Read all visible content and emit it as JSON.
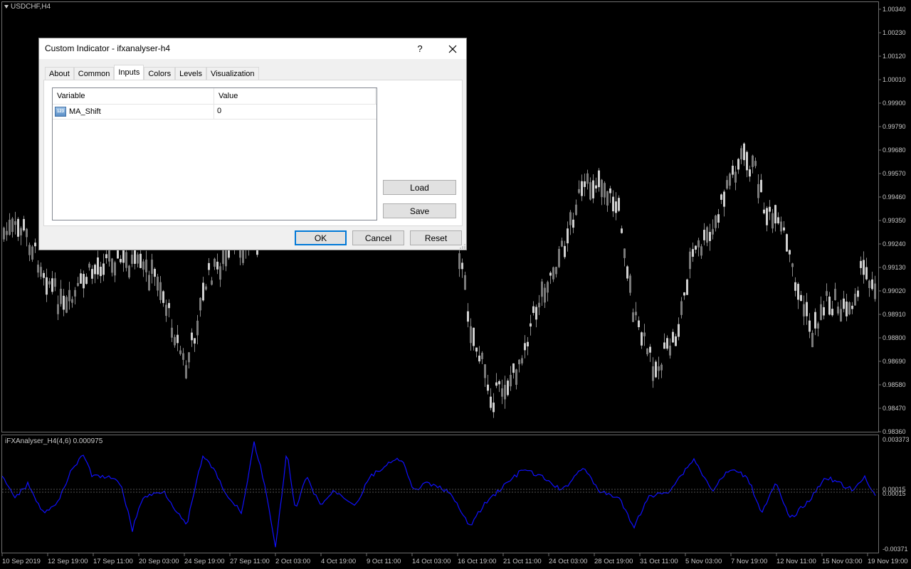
{
  "chart": {
    "symbol_label": "USDCHF,H4",
    "price_axis": [
      "1.00340",
      "1.00230",
      "1.00120",
      "1.00010",
      "0.99900",
      "0.99790",
      "0.99680",
      "0.99570",
      "0.99460",
      "0.99350",
      "0.99240",
      "0.99130",
      "0.99020",
      "0.98910",
      "0.98800",
      "0.98690",
      "0.98580",
      "0.98470",
      "0.98360"
    ],
    "indicator_label": "iFXAnalyser_H4(4,6) 0.000975",
    "indicator_axis_top": "0.003373",
    "indicator_axis_mid1": "0.00015",
    "indicator_axis_mid2": "0.00015",
    "indicator_axis_bottom": "-0.00371",
    "time_axis": [
      "10 Sep 2019",
      "12 Sep 19:00",
      "17 Sep 11:00",
      "20 Sep 03:00",
      "24 Sep 19:00",
      "27 Sep 11:00",
      "2 Oct 03:00",
      "4 Oct 19:00",
      "9 Oct 11:00",
      "14 Oct 03:00",
      "16 Oct 19:00",
      "21 Oct 11:00",
      "24 Oct 03:00",
      "28 Oct 19:00",
      "31 Oct 11:00",
      "5 Nov 03:00",
      "7 Nov 19:00",
      "12 Nov 11:00",
      "15 Nov 03:00",
      "19 Nov 19:00"
    ],
    "colors": {
      "background": "#000000",
      "candles": "#bdbdbd",
      "indicator_line": "#1010ff",
      "grid_dots": "#505050",
      "axis_text": "#c8c8c8"
    }
  },
  "dialog": {
    "title": "Custom Indicator - ifxanalyser-h4",
    "help_label": "?",
    "tabs": [
      {
        "label": "About"
      },
      {
        "label": "Common"
      },
      {
        "label": "Inputs",
        "active": true
      },
      {
        "label": "Colors"
      },
      {
        "label": "Levels"
      },
      {
        "label": "Visualization"
      }
    ],
    "grid": {
      "header_variable": "Variable",
      "header_value": "Value",
      "rows": [
        {
          "variable": "MA_Shift",
          "value": "0",
          "icon": "123-number-icon",
          "icon_text": "123"
        }
      ]
    },
    "buttons": {
      "load": "Load",
      "save": "Save",
      "ok": "OK",
      "cancel": "Cancel",
      "reset": "Reset"
    }
  }
}
